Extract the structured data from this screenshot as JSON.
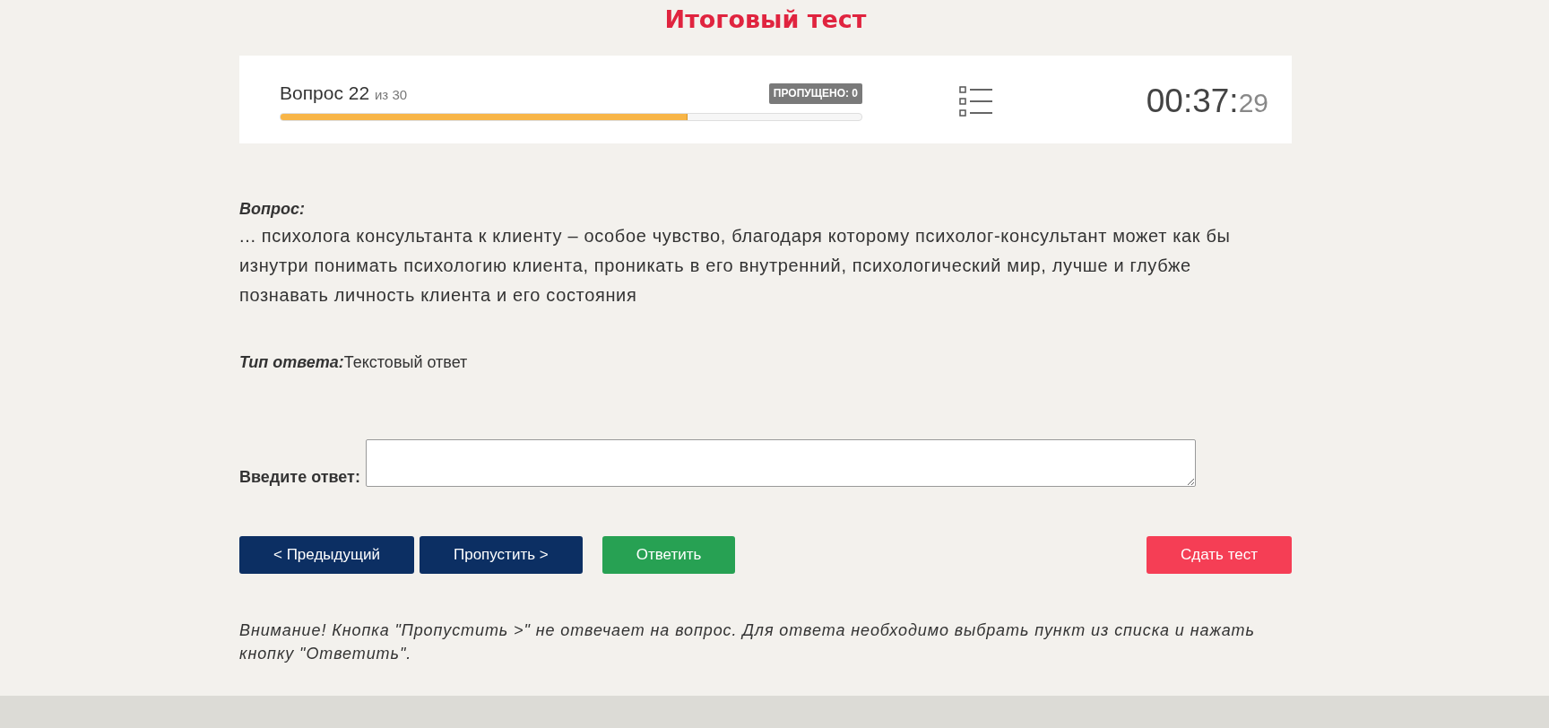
{
  "page": {
    "title": "Итоговый тест"
  },
  "progress_panel": {
    "question_label": "Вопрос 22",
    "question_total": "из 30",
    "skipped_badge": "ПРОПУЩЕНО: 0",
    "level": 0.7,
    "timer": {
      "main": "00:37:",
      "seconds": "29"
    }
  },
  "question": {
    "heading": "Вопрос:",
    "text": "... психолога консультанта к клиенту – особое чувство, благодаря которому психолог-консультант может как бы изнутри понимать психологию клиента, проникать в его внутренний, психологический мир, лучше и глубже познавать личность клиента и его состояния",
    "answer_type_label": "Тип ответа:",
    "answer_type": "Текстовый ответ"
  },
  "answer": {
    "label": "Введите ответ:"
  },
  "buttons": [
    {
      "kind": "nav",
      "label": "< Предыдущий"
    },
    {
      "kind": "nav",
      "label": "Пропустить >"
    },
    {
      "kind": "answer",
      "label": "Ответить"
    },
    {
      "kind": "submit",
      "label": "Сдать тест"
    }
  ],
  "note": "Внимание! Кнопка \"Пропустить >\" не отвечает на вопрос. Для ответа необходимо выбрать пункт из списка и нажать кнопку \"Ответить\"."
}
